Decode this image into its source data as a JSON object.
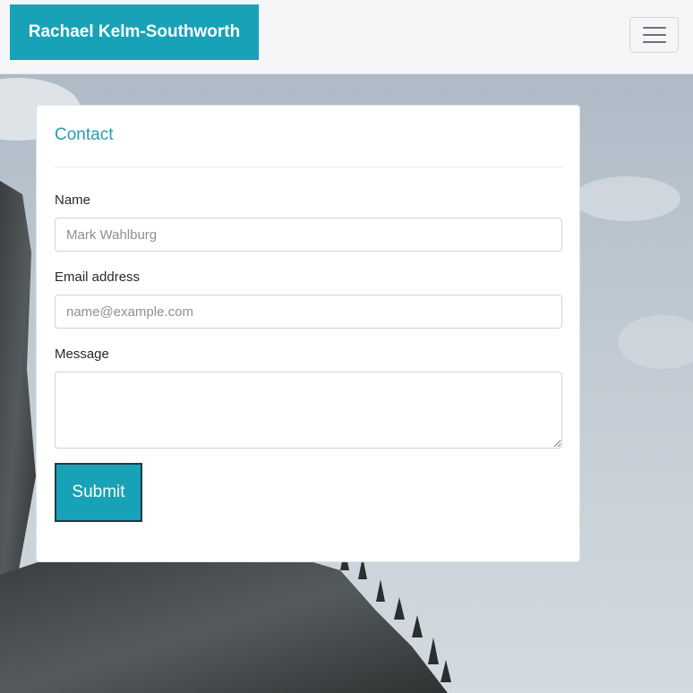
{
  "navbar": {
    "brand": "Rachael Kelm-Southworth",
    "toggler_icon": "hamburger-menu-icon",
    "brand_color": "#17a2b8"
  },
  "contact_form": {
    "title": "Contact",
    "name_label": "Name",
    "name_placeholder": "Mark Wahlburg",
    "email_label": "Email address",
    "email_placeholder": "name@example.com",
    "message_label": "Message",
    "message_value": "",
    "submit_label": "Submit"
  }
}
